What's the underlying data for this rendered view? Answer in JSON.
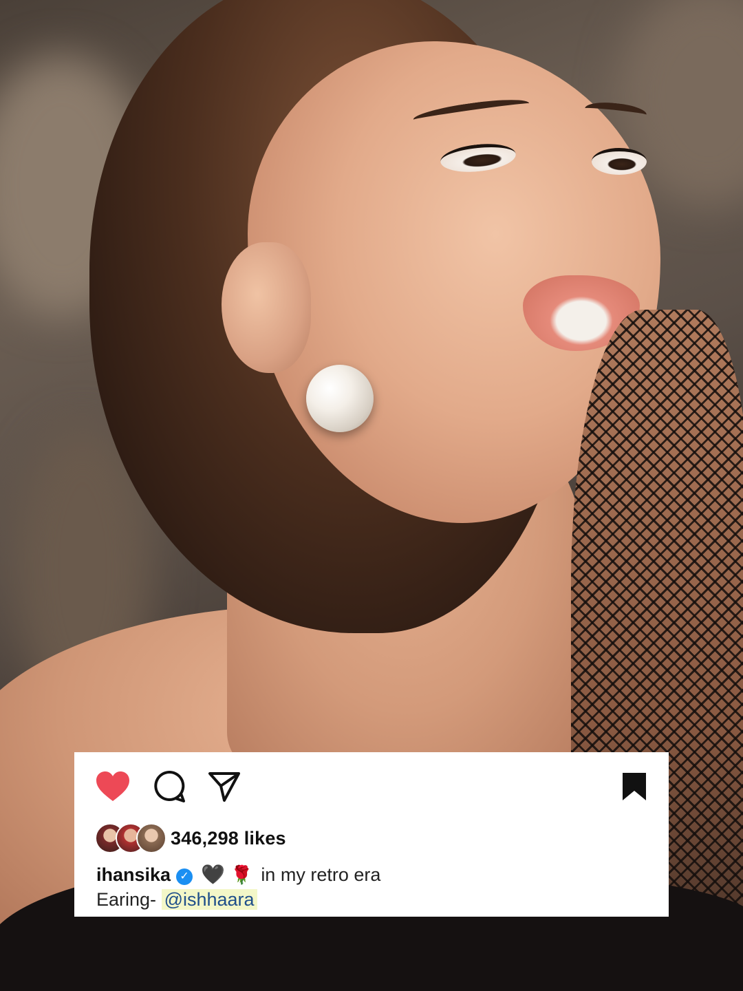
{
  "post": {
    "likes_text": "346,298 likes",
    "username": "ihansika",
    "caption_emojis": [
      "🖤",
      "🌹"
    ],
    "caption_text": "in my retro era",
    "caption_line2_prefix": "Earing-",
    "mention": "@ishhaara"
  },
  "icons": {
    "like": "heart-icon",
    "comment": "comment-icon",
    "share": "paper-plane-icon",
    "save": "bookmark-icon",
    "verified": "verified-badge-icon"
  },
  "colors": {
    "like_red": "#ed4956",
    "verified_blue": "#1b8ff2",
    "text": "#111111",
    "mention_highlight": "#f3f7c8"
  }
}
